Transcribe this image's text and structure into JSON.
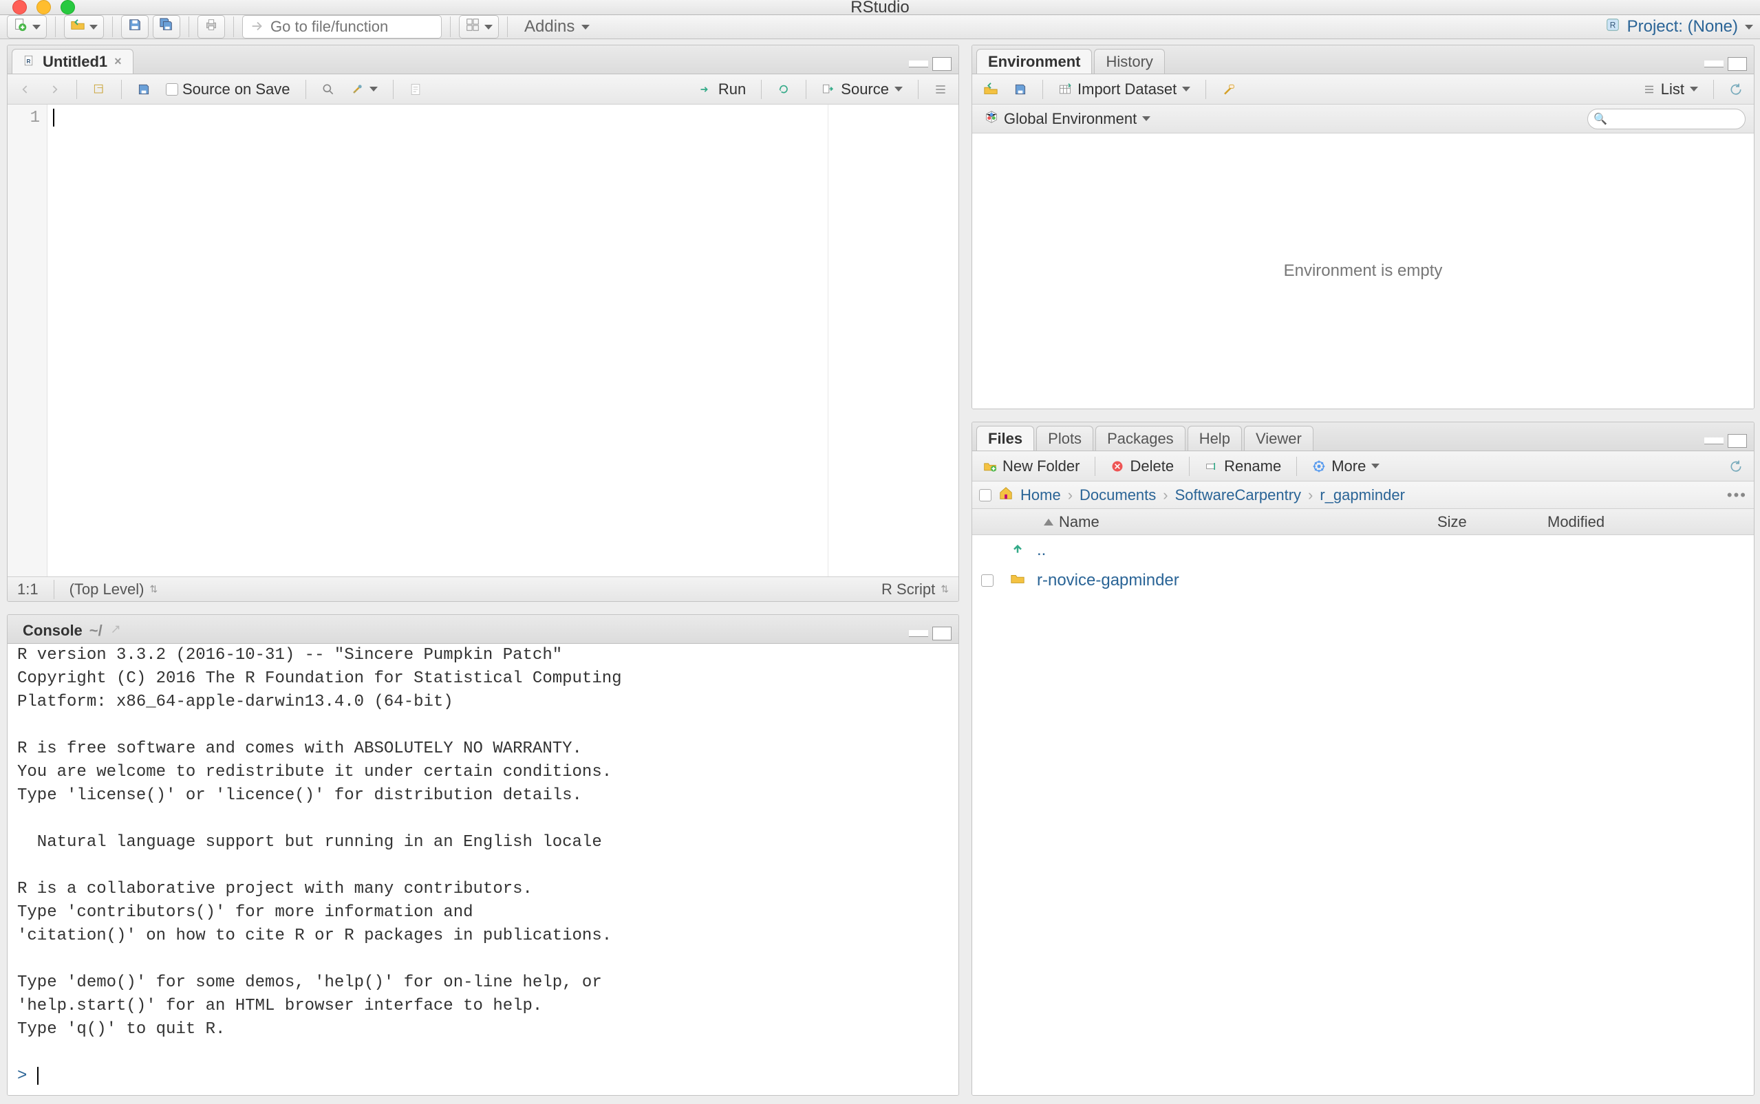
{
  "window": {
    "title": "RStudio"
  },
  "main_toolbar": {
    "addins_label": "Addins",
    "project_label": "Project: (None)",
    "goto_placeholder": "Go to file/function"
  },
  "source_pane": {
    "tab_title": "Untitled1",
    "source_on_save": "Source on Save",
    "run": "Run",
    "source_btn": "Source",
    "status_pos": "1:1",
    "status_scope": "(Top Level)",
    "status_type": "R Script",
    "gutter_line": "1"
  },
  "console_pane": {
    "tab_title": "Console",
    "path": "~/",
    "output": "R version 3.3.2 (2016-10-31) -- \"Sincere Pumpkin Patch\"\nCopyright (C) 2016 The R Foundation for Statistical Computing\nPlatform: x86_64-apple-darwin13.4.0 (64-bit)\n\nR is free software and comes with ABSOLUTELY NO WARRANTY.\nYou are welcome to redistribute it under certain conditions.\nType 'license()' or 'licence()' for distribution details.\n\n  Natural language support but running in an English locale\n\nR is a collaborative project with many contributors.\nType 'contributors()' for more information and\n'citation()' on how to cite R or R packages in publications.\n\nType 'demo()' for some demos, 'help()' for on-line help, or\n'help.start()' for an HTML browser interface to help.\nType 'q()' to quit R.\n",
    "prompt": "> "
  },
  "env_pane": {
    "tabs": {
      "environment": "Environment",
      "history": "History"
    },
    "import": "Import Dataset",
    "view_mode": "List",
    "scope": "Global Environment",
    "empty_msg": "Environment is empty"
  },
  "files_pane": {
    "tabs": {
      "files": "Files",
      "plots": "Plots",
      "packages": "Packages",
      "help": "Help",
      "viewer": "Viewer"
    },
    "new_folder": "New Folder",
    "delete": "Delete",
    "rename": "Rename",
    "more": "More",
    "breadcrumbs": [
      "Home",
      "Documents",
      "SoftwareCarpentry",
      "r_gapminder"
    ],
    "columns": {
      "name": "Name",
      "size": "Size",
      "modified": "Modified"
    },
    "rows": [
      {
        "icon": "up",
        "name": ".."
      },
      {
        "icon": "folder",
        "name": "r-novice-gapminder"
      }
    ]
  }
}
